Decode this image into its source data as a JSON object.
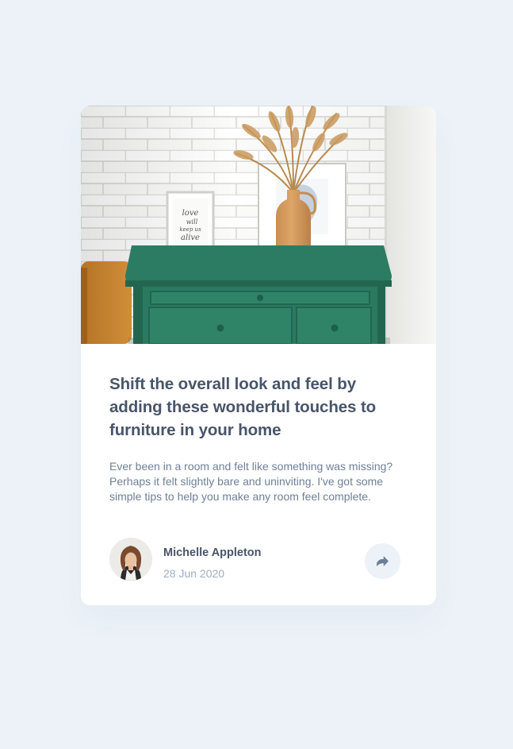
{
  "article": {
    "title": "Shift the overall look and feel by adding these wonderful touches to furniture in your home",
    "excerpt": "Ever been in a room and felt like something was missing? Perhaps it felt slightly bare and uninviting. I've got some simple tips to help you make any room feel complete.",
    "image_alt": "Green drawers with vase and picture frames",
    "frame_text": "love will keep us alive"
  },
  "author": {
    "name": "Michelle Appleton",
    "date": "28 Jun 2020"
  },
  "share": {
    "icon": "share-icon",
    "aria_label": "Share"
  },
  "colors": {
    "page_background": "#ECF2F8",
    "card_background": "#FFFFFF",
    "title": "#48556A",
    "body_text": "#6E8098",
    "muted": "#9DAEC2",
    "share_background": "#ECF2F8",
    "dresser_green": "#2A7A63"
  }
}
